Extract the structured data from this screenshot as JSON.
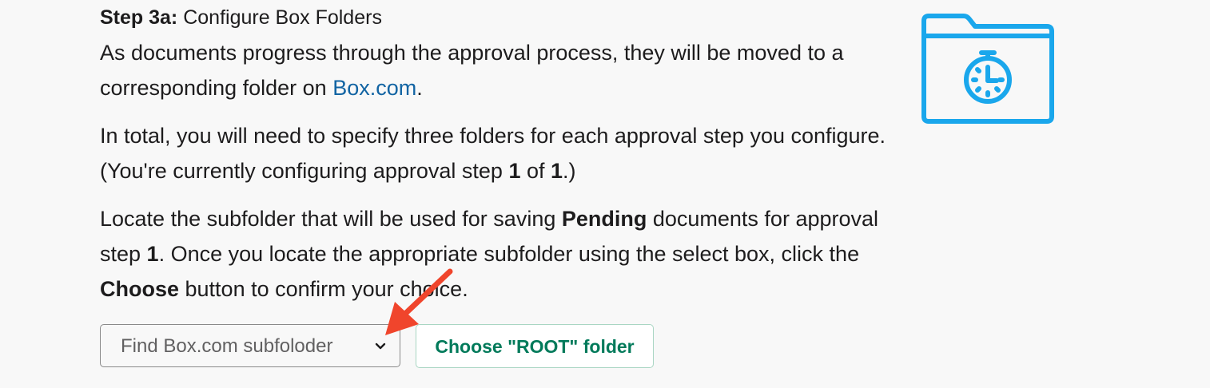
{
  "step": {
    "label": "Step 3a:",
    "title": " Configure Box Folders"
  },
  "para1": {
    "text_before": "As documents progress through the approval process, they will be moved to a corresponding folder on ",
    "link_text": "Box.com",
    "text_after": "."
  },
  "para2": {
    "text_before": "In total, you will need to specify three folders for each approval step you configure. (You're currently configuring approval step ",
    "current_step": "1",
    "of_text": " of ",
    "total_steps": "1",
    "text_after": ".)"
  },
  "para3": {
    "text_before": "Locate the subfolder that will be used for saving ",
    "status_word": "Pending",
    "text_mid1": " documents for approval step ",
    "step_number": "1",
    "text_mid2": ". Once you locate the appropriate subfolder using the select box, click the ",
    "button_word": "Choose",
    "text_after": " button to confirm your choice."
  },
  "controls": {
    "select_placeholder": "Find Box.com subfoloder",
    "choose_button_label": "Choose \"ROOT\" folder"
  },
  "icons": {
    "header_icon": "folder-clock-icon",
    "select_icon": "chevron-down-icon",
    "annotation": "red-arrow-icon"
  },
  "colors": {
    "link": "#1264a3",
    "icon": "#1aa7ec",
    "button_text": "#007a5a",
    "arrow": "#f0452c"
  }
}
